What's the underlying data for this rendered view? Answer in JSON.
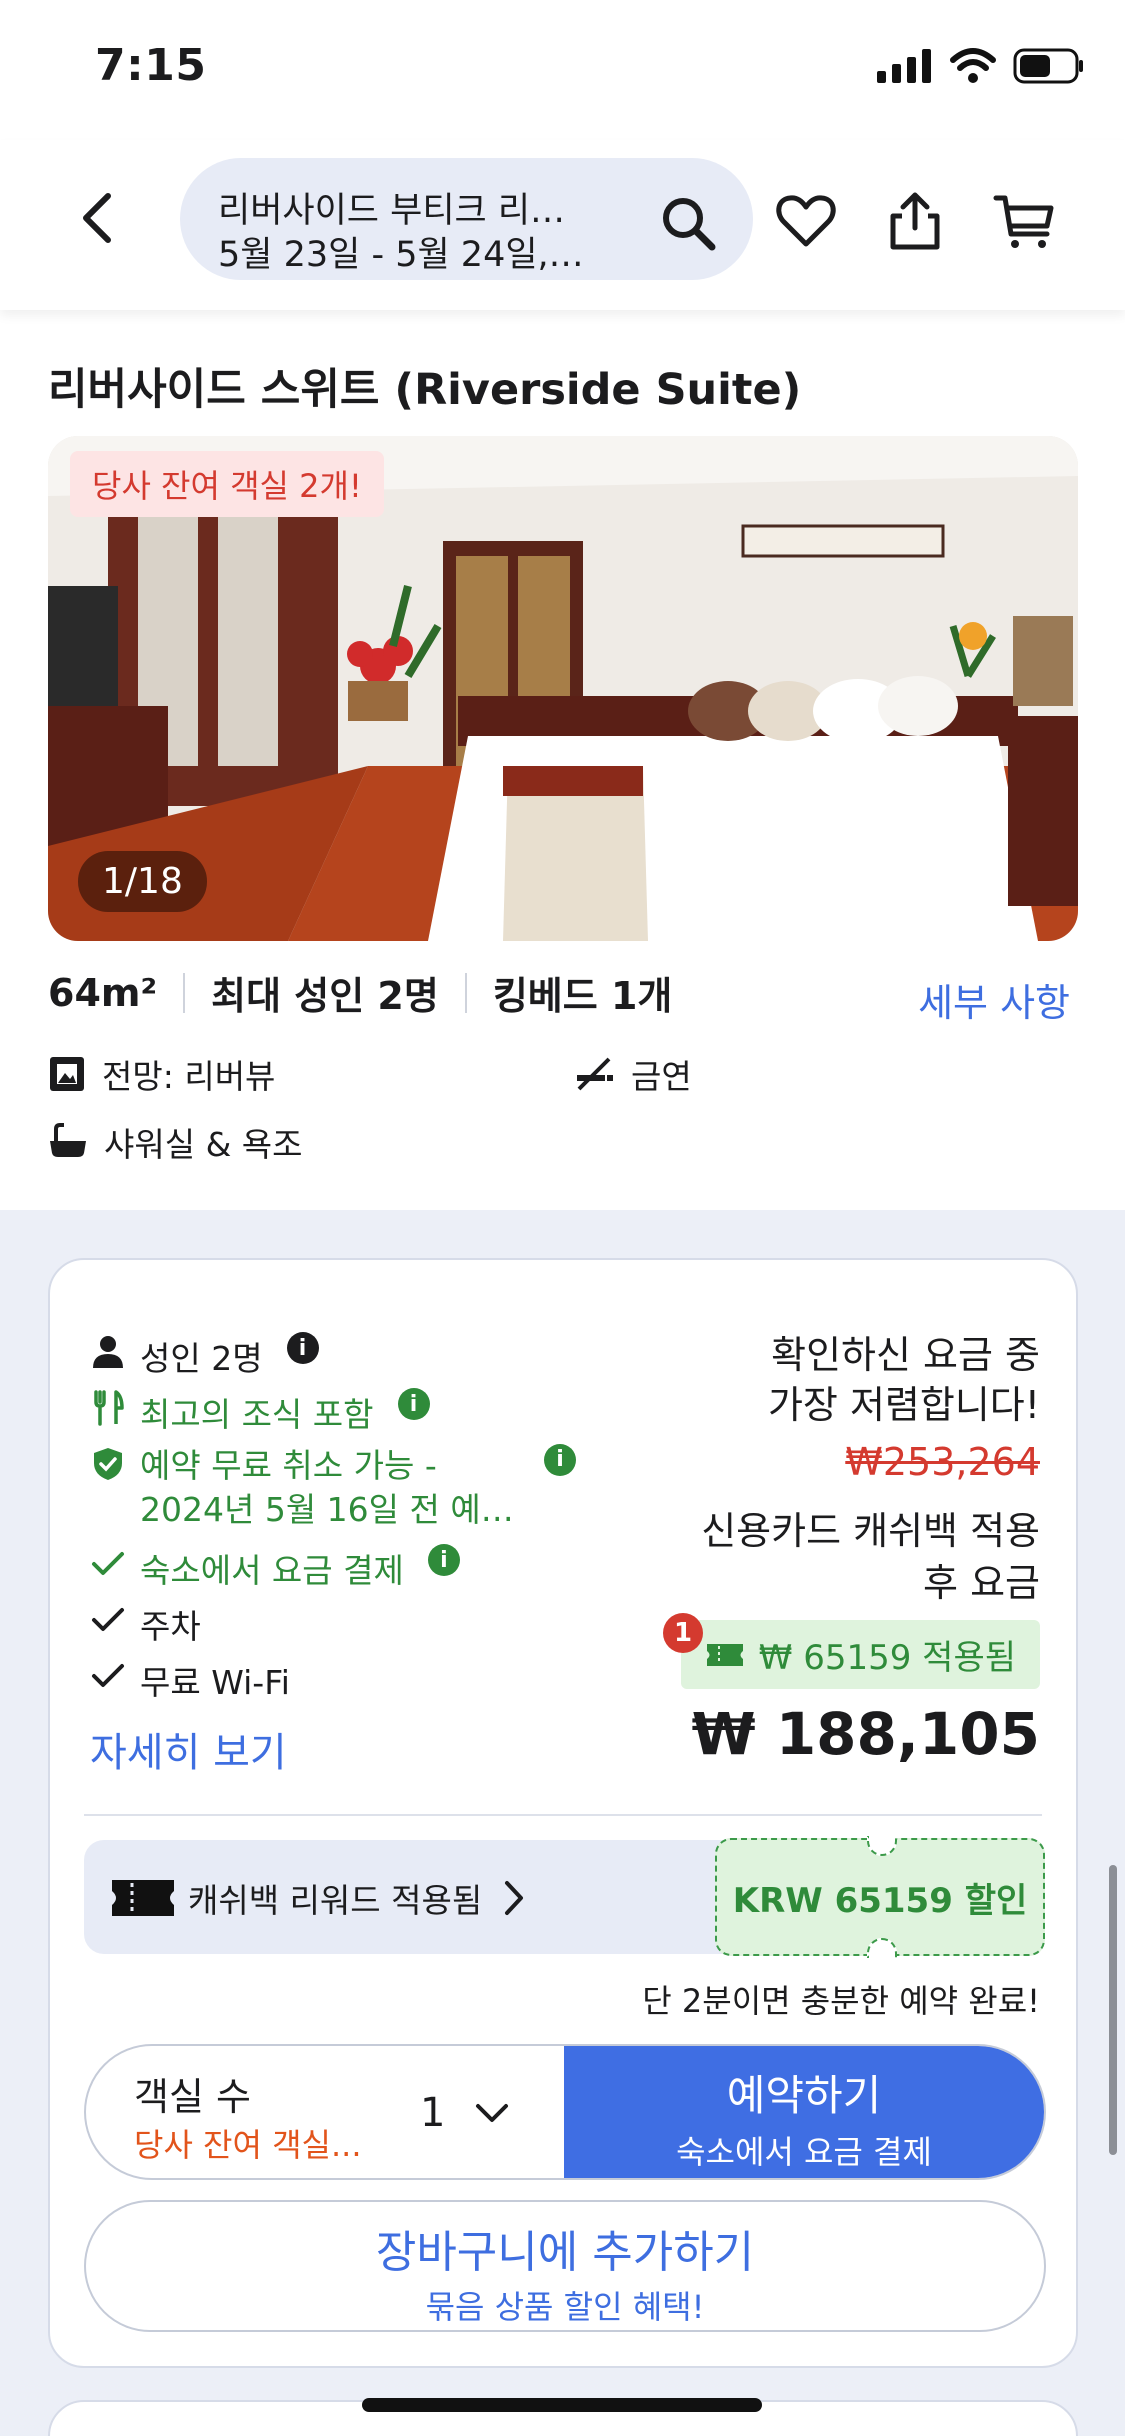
{
  "status": {
    "time": "7:15"
  },
  "header": {
    "search_line1": "리버사이드 부티크 리…",
    "search_line2": "5월 23일 - 5월 24일,…"
  },
  "room": {
    "title": "리버사이드 스위트 (Riverside Suite)",
    "availability_badge": "당사 잔여 객실 2개!",
    "photo_counter": "1/18",
    "size": "64m²",
    "max_guests": "최대 성인 2명",
    "bed": "킹베드 1개",
    "details_link": "세부 사항",
    "amenities": {
      "view": "전망: 리버뷰",
      "smoking": "금연",
      "bath": "샤워실 & 욕조"
    }
  },
  "offer": {
    "guests": "성인 2명",
    "breakfast": "최고의 조식 포함",
    "cancellation": [
      "예약 무료 취소 가능 -",
      "2024년 5월 16일 전 예…"
    ],
    "pay_at_property": "숙소에서 요금 결제",
    "parking": "주차",
    "wifi": "무료 Wi-Fi",
    "more_link": "자세히 보기",
    "price_note": [
      "확인하신 요금 중",
      "가장 저렴합니다!"
    ],
    "original_price": "₩253,264",
    "cashback_note": [
      "신용카드 캐쉬백 적용",
      "후 요금"
    ],
    "badge_count": "1",
    "applied_chip": "₩ 65159 적용됨",
    "final_price": "₩ 188,105",
    "reward_text": "캐쉬백 리워드 적용됨",
    "coupon": "KRW 65159 할인",
    "quick_note": "단 2분이면 충분한 예약 완료!",
    "rooms_label": "객실 수",
    "rooms_left": "당사 잔여 객실...",
    "rooms_qty": "1",
    "reserve_label": "예약하기",
    "reserve_sub": "숙소에서 요금 결제",
    "cart_label": "장바구니에 추가하기",
    "cart_sub": "묶음 상품 할인 혜택!"
  },
  "colors": {
    "accent_blue": "#3e6ee0",
    "green": "#2f8b3a",
    "red": "#d43a2f",
    "orange": "#e2541b"
  }
}
